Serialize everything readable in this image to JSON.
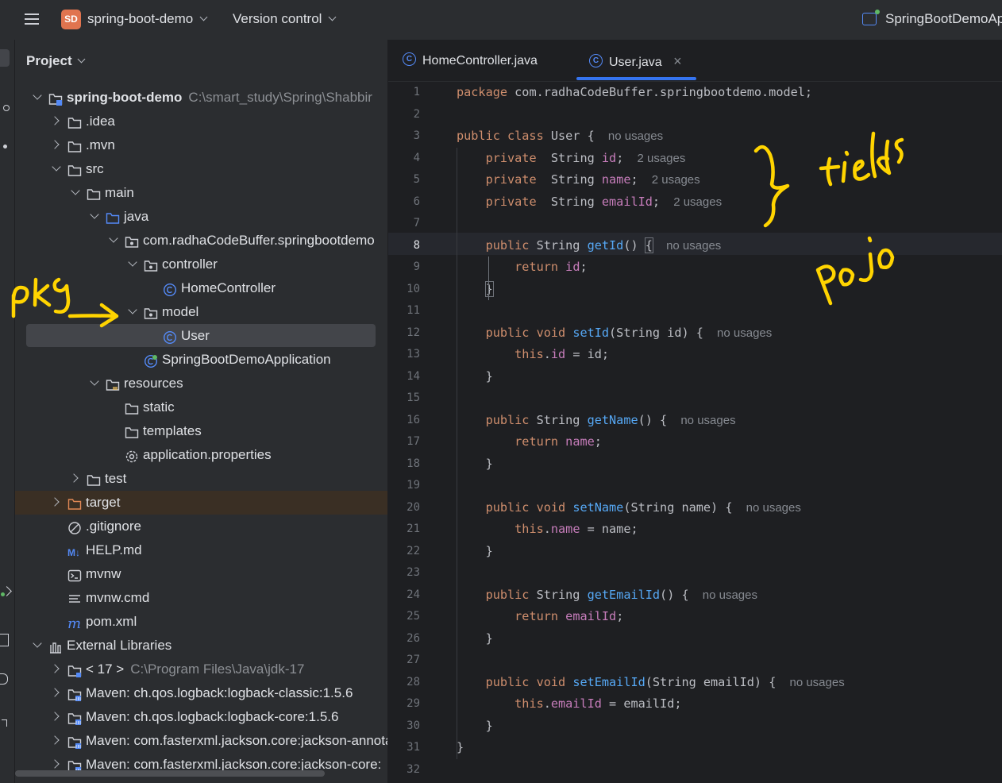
{
  "titlebar": {
    "project_badge": "SD",
    "project_name": "spring-boot-demo",
    "version_control": "Version control",
    "run_config": "SpringBootDemoAp"
  },
  "project_panel": {
    "header": "Project",
    "tree": [
      {
        "label": "spring-boot-demo",
        "path": "C:\\smart_study\\Spring\\Shabbir",
        "icon": "module-folder-icon",
        "expanded": true
      },
      {
        "label": ".idea",
        "icon": "folder-icon",
        "expanded": false
      },
      {
        "label": ".mvn",
        "icon": "folder-icon",
        "expanded": false
      },
      {
        "label": "src",
        "icon": "folder-icon",
        "expanded": true
      },
      {
        "label": "main",
        "icon": "folder-icon",
        "expanded": true
      },
      {
        "label": "java",
        "icon": "source-folder-icon",
        "expanded": true
      },
      {
        "label": "com.radhaCodeBuffer.springbootdemo",
        "icon": "package-icon",
        "expanded": true
      },
      {
        "label": "controller",
        "icon": "package-icon",
        "expanded": true
      },
      {
        "label": "HomeController",
        "icon": "class-icon"
      },
      {
        "label": "model",
        "icon": "package-icon",
        "expanded": true
      },
      {
        "label": "User",
        "icon": "class-icon",
        "selected": true
      },
      {
        "label": "SpringBootDemoApplication",
        "icon": "spring-class-icon"
      },
      {
        "label": "resources",
        "icon": "resources-folder-icon",
        "expanded": true
      },
      {
        "label": "static",
        "icon": "folder-icon"
      },
      {
        "label": "templates",
        "icon": "folder-icon"
      },
      {
        "label": "application.properties",
        "icon": "settings-icon"
      },
      {
        "label": "test",
        "icon": "folder-icon",
        "expanded": false
      },
      {
        "label": "target",
        "icon": "excluded-folder-icon",
        "expanded": false
      },
      {
        "label": ".gitignore",
        "icon": "ignore-icon"
      },
      {
        "label": "HELP.md",
        "icon": "markdown-icon"
      },
      {
        "label": "mvnw",
        "icon": "terminal-icon"
      },
      {
        "label": "mvnw.cmd",
        "icon": "text-lines-icon"
      },
      {
        "label": "pom.xml",
        "icon": "maven-icon"
      },
      {
        "label": "External Libraries",
        "icon": "library-icon",
        "expanded": true
      },
      {
        "label": "< 17 >",
        "path": "C:\\Program Files\\Java\\jdk-17",
        "icon": "jdk-folder-icon",
        "expanded": false
      },
      {
        "label": "Maven: ch.qos.logback:logback-classic:1.5.6",
        "icon": "jar-icon",
        "expanded": false
      },
      {
        "label": "Maven: ch.qos.logback:logback-core:1.5.6",
        "icon": "jar-icon",
        "expanded": false
      },
      {
        "label": "Maven: com.fasterxml.jackson.core:jackson-annotations",
        "icon": "jar-icon",
        "expanded": false
      },
      {
        "label": "Maven: com.fasterxml.jackson.core:jackson-core:",
        "icon": "jar-icon",
        "expanded": false
      }
    ]
  },
  "editor": {
    "tabs": [
      {
        "label": "HomeController.java",
        "active": false
      },
      {
        "label": "User.java",
        "active": true,
        "close": "×"
      }
    ],
    "current_line": 8,
    "lines": [
      [
        [
          "kw",
          "package "
        ],
        [
          "plain",
          "com.radhaCodeBuffer.springbootdemo.model;"
        ]
      ],
      [],
      [
        [
          "kw",
          "public class "
        ],
        [
          "plain",
          "User { "
        ],
        [
          "hint",
          "no usages"
        ]
      ],
      [
        [
          "plain",
          "    "
        ],
        [
          "kw",
          "private  "
        ],
        [
          "plain",
          "String "
        ],
        [
          "fld",
          "id"
        ],
        [
          "plain",
          "; "
        ],
        [
          "hint",
          "2 usages"
        ]
      ],
      [
        [
          "plain",
          "    "
        ],
        [
          "kw",
          "private  "
        ],
        [
          "plain",
          "String "
        ],
        [
          "fld",
          "name"
        ],
        [
          "plain",
          "; "
        ],
        [
          "hint",
          "2 usages"
        ]
      ],
      [
        [
          "plain",
          "    "
        ],
        [
          "kw",
          "private  "
        ],
        [
          "plain",
          "String "
        ],
        [
          "fld",
          "emailId"
        ],
        [
          "plain",
          "; "
        ],
        [
          "hint",
          "2 usages"
        ]
      ],
      [],
      [
        [
          "plain",
          "    "
        ],
        [
          "kw",
          "public "
        ],
        [
          "plain",
          "String "
        ],
        [
          "fn",
          "getId"
        ],
        [
          "plain",
          "() "
        ],
        [
          "box",
          "{"
        ],
        [
          "plain",
          " "
        ],
        [
          "hint",
          "no usages"
        ]
      ],
      [
        [
          "plain",
          "        "
        ],
        [
          "kw",
          "return "
        ],
        [
          "fld",
          "id"
        ],
        [
          "plain",
          ";"
        ]
      ],
      [
        [
          "plain",
          "    "
        ],
        [
          "box",
          "}"
        ]
      ],
      [],
      [
        [
          "plain",
          "    "
        ],
        [
          "kw",
          "public void "
        ],
        [
          "fn",
          "setId"
        ],
        [
          "plain",
          "(String id) { "
        ],
        [
          "hint",
          "no usages"
        ]
      ],
      [
        [
          "plain",
          "        "
        ],
        [
          "kw",
          "this"
        ],
        [
          "plain",
          "."
        ],
        [
          "fld",
          "id"
        ],
        [
          "plain",
          " = id;"
        ]
      ],
      [
        [
          "plain",
          "    }"
        ]
      ],
      [],
      [
        [
          "plain",
          "    "
        ],
        [
          "kw",
          "public "
        ],
        [
          "plain",
          "String "
        ],
        [
          "fn",
          "getName"
        ],
        [
          "plain",
          "() { "
        ],
        [
          "hint",
          "no usages"
        ]
      ],
      [
        [
          "plain",
          "        "
        ],
        [
          "kw",
          "return "
        ],
        [
          "fld",
          "name"
        ],
        [
          "plain",
          ";"
        ]
      ],
      [
        [
          "plain",
          "    }"
        ]
      ],
      [],
      [
        [
          "plain",
          "    "
        ],
        [
          "kw",
          "public void "
        ],
        [
          "fn",
          "setName"
        ],
        [
          "plain",
          "(String name) { "
        ],
        [
          "hint",
          "no usages"
        ]
      ],
      [
        [
          "plain",
          "        "
        ],
        [
          "kw",
          "this"
        ],
        [
          "plain",
          "."
        ],
        [
          "fld",
          "name"
        ],
        [
          "plain",
          " = name;"
        ]
      ],
      [
        [
          "plain",
          "    }"
        ]
      ],
      [],
      [
        [
          "plain",
          "    "
        ],
        [
          "kw",
          "public "
        ],
        [
          "plain",
          "String "
        ],
        [
          "fn",
          "getEmailId"
        ],
        [
          "plain",
          "() { "
        ],
        [
          "hint",
          "no usages"
        ]
      ],
      [
        [
          "plain",
          "        "
        ],
        [
          "kw",
          "return "
        ],
        [
          "fld",
          "emailId"
        ],
        [
          "plain",
          ";"
        ]
      ],
      [
        [
          "plain",
          "    }"
        ]
      ],
      [],
      [
        [
          "plain",
          "    "
        ],
        [
          "kw",
          "public void "
        ],
        [
          "fn",
          "setEmailId"
        ],
        [
          "plain",
          "(String emailId) { "
        ],
        [
          "hint",
          "no usages"
        ]
      ],
      [
        [
          "plain",
          "        "
        ],
        [
          "kw",
          "this"
        ],
        [
          "plain",
          "."
        ],
        [
          "fld",
          "emailId"
        ],
        [
          "plain",
          " = emailId;"
        ]
      ],
      [
        [
          "plain",
          "    }"
        ]
      ],
      [
        [
          "plain",
          "}"
        ]
      ],
      []
    ]
  },
  "colors": {
    "keyword": "#cf8e6d",
    "field": "#c77dbb",
    "method": "#56a8f5",
    "annotation_ink": "#ffd400",
    "accent": "#3574f0"
  }
}
